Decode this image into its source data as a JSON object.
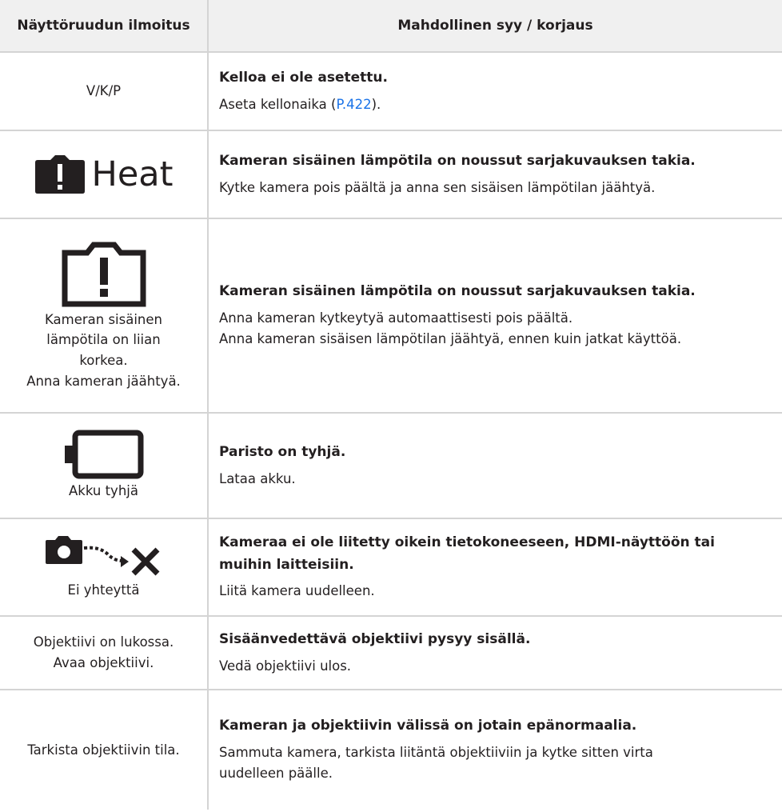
{
  "header": {
    "col1": "Näyttöruudun ilmoitus",
    "col2": "Mahdollinen syy / korjaus"
  },
  "rows": [
    {
      "indicator": "V/K/P",
      "cause": "Kelloa ei ole asetettu.",
      "fix_before": "Aseta kellonaika (",
      "fix_link": "P.422",
      "fix_after": ")."
    },
    {
      "indicator_icon": "camera-warning-icon",
      "indicator_text": "Heat",
      "cause": "Kameran sisäinen lämpötila on noussut sarjakuvauksen takia.",
      "fix": "Kytke kamera pois päältä ja anna sen sisäisen lämpötilan jäähtyä."
    },
    {
      "indicator_icon": "camera-warning-outline-icon",
      "indicator_lines": [
        "Kameran sisäinen",
        "lämpötila on liian",
        "korkea.",
        "Anna kameran jäähtyä."
      ],
      "cause": "Kameran sisäinen lämpötila on noussut sarjakuvauksen takia.",
      "fix_lines": [
        "Anna kameran kytkeytyä automaattisesti pois päältä.",
        "Anna kameran sisäisen lämpötilan jäähtyä, ennen kuin jatkat käyttöä."
      ]
    },
    {
      "indicator_icon": "battery-empty-icon",
      "indicator_text": "Akku tyhjä",
      "cause": "Paristo on tyhjä.",
      "fix": "Lataa akku."
    },
    {
      "indicator_icon": "no-connection-icon",
      "indicator_text": "Ei yhteyttä",
      "cause_lines": [
        "Kameraa ei ole liitetty oikein tietokoneeseen, HDMI-näyttöön tai",
        "muihin laitteisiin."
      ],
      "fix": "Liitä kamera uudelleen."
    },
    {
      "indicator_lines": [
        "Objektiivi on lukossa.",
        "Avaa objektiivi."
      ],
      "cause": "Sisäänvedettävä objektiivi pysyy sisällä.",
      "fix": "Vedä objektiivi ulos."
    },
    {
      "indicator": "Tarkista objektiivin tila.",
      "cause": "Kameran ja objektiivin välissä on jotain epänormaalia.",
      "fix_lines": [
        "Sammuta kamera, tarkista liitäntä objektiiviin ja kytke sitten virta",
        "uudelleen päälle."
      ]
    }
  ]
}
